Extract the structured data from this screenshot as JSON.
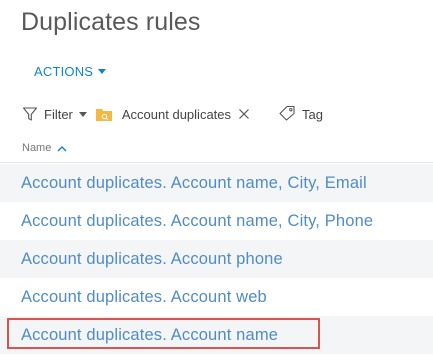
{
  "page": {
    "title": "Duplicates rules"
  },
  "toolbar": {
    "actions_label": "ACTIONS"
  },
  "filters": {
    "filter_label": "Filter",
    "folder_name": "Account duplicates",
    "tag_label": "Tag"
  },
  "table": {
    "column_header": "Name",
    "sort": "ascending",
    "rows": [
      {
        "label": "Account duplicates. Account name, City, Email"
      },
      {
        "label": "Account duplicates. Account name, City, Phone"
      },
      {
        "label": "Account duplicates. Account phone"
      },
      {
        "label": "Account duplicates. Account web"
      },
      {
        "label": "Account duplicates. Account name"
      }
    ]
  },
  "colors": {
    "link": "#4f8cc9",
    "accent": "#0e84cf",
    "highlight_border": "#d9534f",
    "folder_icon": "#f4b942"
  }
}
